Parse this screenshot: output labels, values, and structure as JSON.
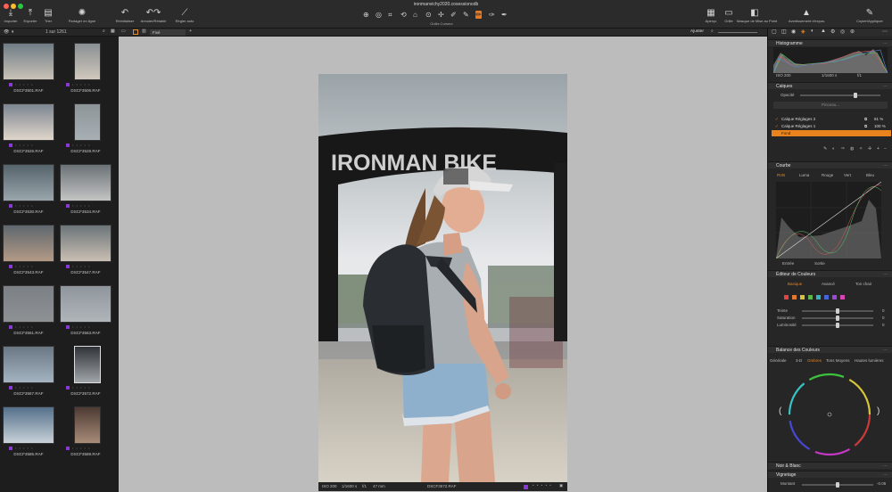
{
  "window_title": "ironmanvichy2020.cosessionodb",
  "toolbar_left": [
    {
      "name": "import",
      "label": "Importer",
      "icon": "⤓"
    },
    {
      "name": "export",
      "label": "Exporter",
      "icon": "⤒"
    },
    {
      "name": "sort",
      "label": "Trier",
      "icon": "▤"
    }
  ],
  "toolbar_mid": [
    {
      "name": "share",
      "label": "Partager en ligne",
      "icon": "✺"
    },
    {
      "name": "reset",
      "label": "Réinitialiser",
      "icon": "↶"
    },
    {
      "name": "undo-redo",
      "label": "Annuler/Rétablir",
      "icon": "↶↷"
    },
    {
      "name": "straighten",
      "label": "Régler auto",
      "icon": "⟋"
    }
  ],
  "toolbar_right": [
    {
      "name": "view",
      "label": "Aperçu",
      "icon": "▦"
    },
    {
      "name": "grid",
      "label": "Grille",
      "icon": "▭"
    },
    {
      "name": "focus-mask",
      "label": "Masque de Mise au Point",
      "icon": "◧"
    },
    {
      "name": "exposure-warning",
      "label": "Avertissement d'expos.",
      "icon": "▲"
    },
    {
      "name": "copy-apply",
      "label": "Copier/Appliquer",
      "icon": "✎"
    }
  ],
  "tools_label": "Outils Curseur",
  "browser": {
    "count": "1 sur 1261",
    "files": [
      "DSCF3501.RAF",
      "DSCF3506.RAF",
      "DSCF3526.RAF",
      "DSCF3528.RAF",
      "DSCF3530.RAF",
      "DSCF3534.RAF",
      "DSCF3543.RAF",
      "DSCF3547.RAF",
      "DSCF3561.RAF",
      "DSCF3563.RAF",
      "DSCF3567.RAF",
      "DSCF3572.RAF",
      "DSCF3585.RAF",
      "DSCF3589.RAF"
    ]
  },
  "viewer": {
    "preset": "Fixé",
    "fit_label": "Ajuster",
    "meta": {
      "iso": "ISO 200",
      "shutter": "1/1600 s",
      "aperture": "f/1",
      "focal": "47 mm",
      "file": "DSCF3572.RAF"
    }
  },
  "photo": {
    "banner_text": "IRONMAN BIKE"
  },
  "panel": {
    "histogram": {
      "title": "Histogramme",
      "iso": "ISO 200",
      "shutter": "1/1600 s",
      "aperture": "f/1"
    },
    "layers": {
      "title": "Calques",
      "opacity_label": "Opacité",
      "placeholder": "Pinceau...",
      "items": [
        {
          "name": "Calque Réglages 2",
          "value": "81 %"
        },
        {
          "name": "Calque Réglages 1",
          "value": "100 %"
        },
        {
          "name": "Fond",
          "value": ""
        }
      ]
    },
    "curve": {
      "title": "Courbe",
      "tabs": [
        "RVB",
        "Luma",
        "Rouge",
        "Vert",
        "Bleu"
      ],
      "input_label": "Entrée",
      "output_label": "Sortie"
    },
    "color_editor": {
      "title": "Éditeur de Couleurs",
      "tabs": [
        "Basique",
        "Avancé",
        "Ton chair"
      ],
      "swatches": [
        "#e04444",
        "#e07a33",
        "#d8c23a",
        "#5cb84a",
        "#39b3c2",
        "#4466d8",
        "#9b48d8",
        "#d845b0"
      ],
      "sliders": [
        {
          "label": "Teinte",
          "value": "0"
        },
        {
          "label": "Saturation",
          "value": "0"
        },
        {
          "label": "Luminosité",
          "value": "0"
        }
      ]
    },
    "color_balance": {
      "title": "Balance des Couleurs",
      "tabs": [
        "Générale",
        "3-D",
        "Ombres",
        "Tons Moyens",
        "Hautes lumières"
      ]
    },
    "bw_title": "Noir & Blanc",
    "vignette": {
      "title": "Vignetage",
      "amount_label": "Montant",
      "amount_value": "-0.05"
    }
  }
}
